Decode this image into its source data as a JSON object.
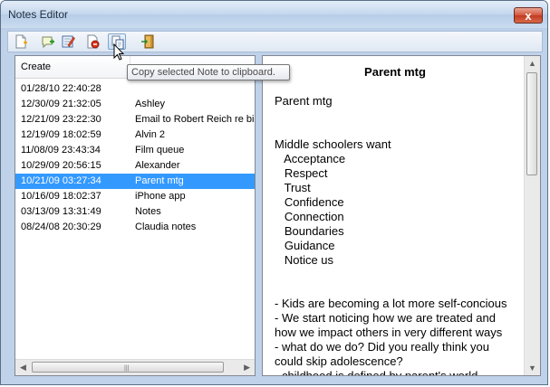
{
  "window": {
    "title": "Notes Editor",
    "close_label": "x"
  },
  "toolbar": {
    "buttons": [
      {
        "name": "new-note-icon"
      },
      {
        "name": "add-note-icon"
      },
      {
        "name": "edit-note-icon"
      },
      {
        "name": "delete-note-icon"
      },
      {
        "name": "copy-note-icon"
      },
      {
        "name": "exit-icon"
      }
    ],
    "tooltip": "Copy selected Note to clipboard."
  },
  "list": {
    "columns": [
      "Create",
      ""
    ],
    "rows": [
      {
        "date": "01/28/10 22:40:28",
        "title": ""
      },
      {
        "date": "12/30/09 21:32:05",
        "title": "Ashley"
      },
      {
        "date": "12/21/09 23:22:30",
        "title": "Email to Robert Reich re biz"
      },
      {
        "date": "12/19/09 18:02:59",
        "title": "Alvin 2"
      },
      {
        "date": "11/08/09 23:43:34",
        "title": "Film queue"
      },
      {
        "date": "10/29/09 20:56:15",
        "title": "Alexander"
      },
      {
        "date": "10/21/09 03:27:34",
        "title": "Parent mtg",
        "selected": true
      },
      {
        "date": "10/16/09 18:02:37",
        "title": "iPhone app"
      },
      {
        "date": "03/13/09 13:31:49",
        "title": "Notes"
      },
      {
        "date": "08/24/08 20:30:29",
        "title": "Claudia notes"
      }
    ]
  },
  "detail": {
    "title": "Parent mtg",
    "lines": [
      "Parent mtg",
      "",
      "",
      "Middle schoolers want",
      "   Acceptance",
      "   Respect",
      "   Trust",
      "   Confidence",
      "   Connection",
      "   Boundaries",
      "   Guidance",
      "   Notice us",
      "",
      "",
      "- Kids are becoming a lot more self-concious",
      "- We start noticing how we are treated and",
      "how we impact others in very different ways",
      "- what do we do? Did you really think you",
      "could skip adolescence?",
      "- childhood is defined by parent's world"
    ]
  },
  "colors": {
    "selection": "#3399ff",
    "titlebar": "#c4d7ee",
    "close": "#c23a21"
  }
}
